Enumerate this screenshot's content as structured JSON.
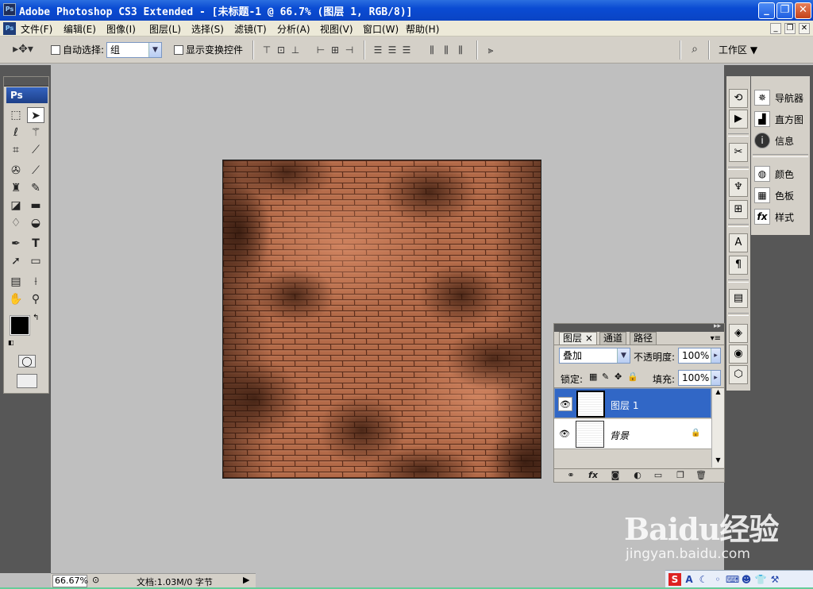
{
  "window": {
    "title": "Adobe Photoshop CS3 Extended - [未标题-1 @ 66.7% (图层 1, RGB/8)]",
    "app_icon": "Ps",
    "minimize_icon": "minimize-icon",
    "maximize_icon": "restore-icon",
    "close_icon": "close-icon"
  },
  "menu": {
    "items": [
      "文件(F)",
      "编辑(E)",
      "图像(I)",
      "图层(L)",
      "选择(S)",
      "滤镜(T)",
      "分析(A)",
      "视图(V)",
      "窗口(W)",
      "帮助(H)"
    ],
    "app_icon": "Ps"
  },
  "options": {
    "auto_select_label": "自动选择:",
    "auto_select_checked": false,
    "group_value": "组",
    "show_transform_label": "显示变换控件",
    "show_transform_checked": false,
    "workspace_label": "工作区"
  },
  "toolbox": {
    "logo": "Ps",
    "foreground_color": "#000000",
    "background_color": "#ffffff"
  },
  "dock": {
    "panels": [
      "导航器",
      "直方图",
      "信息",
      "颜色",
      "色板",
      "样式"
    ]
  },
  "layers_panel": {
    "tabs": [
      "图层",
      "通道",
      "路径"
    ],
    "blend_mode": "叠加",
    "opacity_label": "不透明度:",
    "opacity_value": "100%",
    "lock_label": "锁定:",
    "fill_label": "填充:",
    "fill_value": "100%",
    "layers": [
      {
        "name": "图层 1",
        "selected": true,
        "visible": true,
        "locked": false
      },
      {
        "name": "背景",
        "selected": false,
        "visible": true,
        "locked": true
      }
    ]
  },
  "status": {
    "zoom": "66.67%",
    "doc_info": "文档:1.03M/0 字节"
  },
  "watermark": {
    "brand": "Baidu经验",
    "url": "jingyan.baidu.com"
  },
  "colors": {
    "titlebar": "#0a4bd3",
    "selection": "#3167c6",
    "brick": "#a85a3a"
  }
}
